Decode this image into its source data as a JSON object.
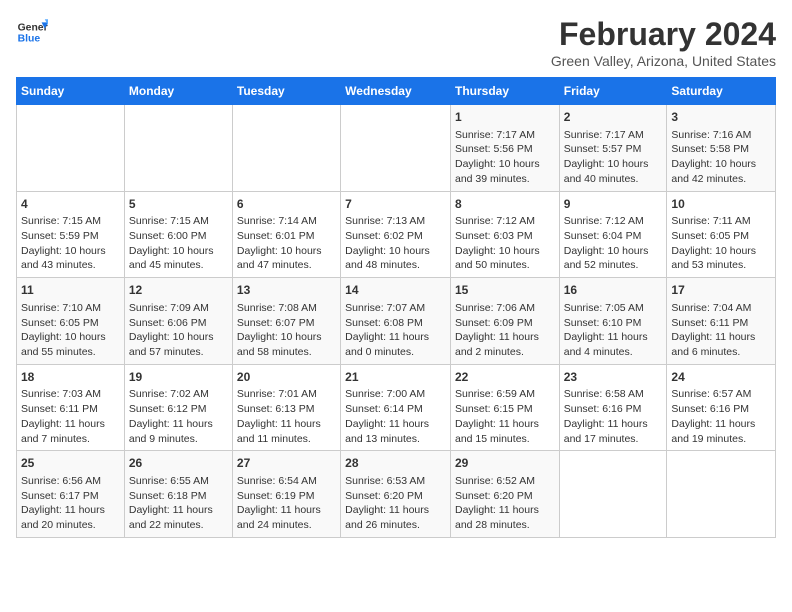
{
  "header": {
    "logo_line1": "General",
    "logo_line2": "Blue",
    "title": "February 2024",
    "subtitle": "Green Valley, Arizona, United States"
  },
  "days_of_week": [
    "Sunday",
    "Monday",
    "Tuesday",
    "Wednesday",
    "Thursday",
    "Friday",
    "Saturday"
  ],
  "weeks": [
    [
      {
        "day": "",
        "content": ""
      },
      {
        "day": "",
        "content": ""
      },
      {
        "day": "",
        "content": ""
      },
      {
        "day": "",
        "content": ""
      },
      {
        "day": "1",
        "content": "Sunrise: 7:17 AM\nSunset: 5:56 PM\nDaylight: 10 hours\nand 39 minutes."
      },
      {
        "day": "2",
        "content": "Sunrise: 7:17 AM\nSunset: 5:57 PM\nDaylight: 10 hours\nand 40 minutes."
      },
      {
        "day": "3",
        "content": "Sunrise: 7:16 AM\nSunset: 5:58 PM\nDaylight: 10 hours\nand 42 minutes."
      }
    ],
    [
      {
        "day": "4",
        "content": "Sunrise: 7:15 AM\nSunset: 5:59 PM\nDaylight: 10 hours\nand 43 minutes."
      },
      {
        "day": "5",
        "content": "Sunrise: 7:15 AM\nSunset: 6:00 PM\nDaylight: 10 hours\nand 45 minutes."
      },
      {
        "day": "6",
        "content": "Sunrise: 7:14 AM\nSunset: 6:01 PM\nDaylight: 10 hours\nand 47 minutes."
      },
      {
        "day": "7",
        "content": "Sunrise: 7:13 AM\nSunset: 6:02 PM\nDaylight: 10 hours\nand 48 minutes."
      },
      {
        "day": "8",
        "content": "Sunrise: 7:12 AM\nSunset: 6:03 PM\nDaylight: 10 hours\nand 50 minutes."
      },
      {
        "day": "9",
        "content": "Sunrise: 7:12 AM\nSunset: 6:04 PM\nDaylight: 10 hours\nand 52 minutes."
      },
      {
        "day": "10",
        "content": "Sunrise: 7:11 AM\nSunset: 6:05 PM\nDaylight: 10 hours\nand 53 minutes."
      }
    ],
    [
      {
        "day": "11",
        "content": "Sunrise: 7:10 AM\nSunset: 6:05 PM\nDaylight: 10 hours\nand 55 minutes."
      },
      {
        "day": "12",
        "content": "Sunrise: 7:09 AM\nSunset: 6:06 PM\nDaylight: 10 hours\nand 57 minutes."
      },
      {
        "day": "13",
        "content": "Sunrise: 7:08 AM\nSunset: 6:07 PM\nDaylight: 10 hours\nand 58 minutes."
      },
      {
        "day": "14",
        "content": "Sunrise: 7:07 AM\nSunset: 6:08 PM\nDaylight: 11 hours\nand 0 minutes."
      },
      {
        "day": "15",
        "content": "Sunrise: 7:06 AM\nSunset: 6:09 PM\nDaylight: 11 hours\nand 2 minutes."
      },
      {
        "day": "16",
        "content": "Sunrise: 7:05 AM\nSunset: 6:10 PM\nDaylight: 11 hours\nand 4 minutes."
      },
      {
        "day": "17",
        "content": "Sunrise: 7:04 AM\nSunset: 6:11 PM\nDaylight: 11 hours\nand 6 minutes."
      }
    ],
    [
      {
        "day": "18",
        "content": "Sunrise: 7:03 AM\nSunset: 6:11 PM\nDaylight: 11 hours\nand 7 minutes."
      },
      {
        "day": "19",
        "content": "Sunrise: 7:02 AM\nSunset: 6:12 PM\nDaylight: 11 hours\nand 9 minutes."
      },
      {
        "day": "20",
        "content": "Sunrise: 7:01 AM\nSunset: 6:13 PM\nDaylight: 11 hours\nand 11 minutes."
      },
      {
        "day": "21",
        "content": "Sunrise: 7:00 AM\nSunset: 6:14 PM\nDaylight: 11 hours\nand 13 minutes."
      },
      {
        "day": "22",
        "content": "Sunrise: 6:59 AM\nSunset: 6:15 PM\nDaylight: 11 hours\nand 15 minutes."
      },
      {
        "day": "23",
        "content": "Sunrise: 6:58 AM\nSunset: 6:16 PM\nDaylight: 11 hours\nand 17 minutes."
      },
      {
        "day": "24",
        "content": "Sunrise: 6:57 AM\nSunset: 6:16 PM\nDaylight: 11 hours\nand 19 minutes."
      }
    ],
    [
      {
        "day": "25",
        "content": "Sunrise: 6:56 AM\nSunset: 6:17 PM\nDaylight: 11 hours\nand 20 minutes."
      },
      {
        "day": "26",
        "content": "Sunrise: 6:55 AM\nSunset: 6:18 PM\nDaylight: 11 hours\nand 22 minutes."
      },
      {
        "day": "27",
        "content": "Sunrise: 6:54 AM\nSunset: 6:19 PM\nDaylight: 11 hours\nand 24 minutes."
      },
      {
        "day": "28",
        "content": "Sunrise: 6:53 AM\nSunset: 6:20 PM\nDaylight: 11 hours\nand 26 minutes."
      },
      {
        "day": "29",
        "content": "Sunrise: 6:52 AM\nSunset: 6:20 PM\nDaylight: 11 hours\nand 28 minutes."
      },
      {
        "day": "",
        "content": ""
      },
      {
        "day": "",
        "content": ""
      }
    ]
  ]
}
